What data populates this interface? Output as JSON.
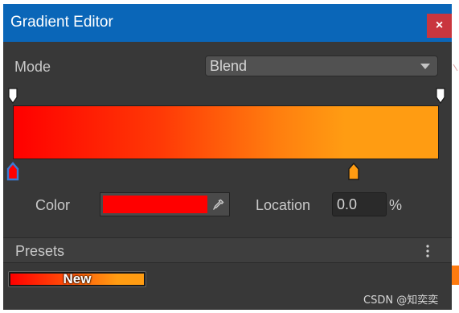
{
  "window": {
    "title": "Gradient Editor",
    "close_label": "×"
  },
  "mode": {
    "label": "Mode",
    "value": "Blend"
  },
  "gradient": {
    "alpha_keys": [
      "alpha-key-start",
      "alpha-key-end"
    ],
    "color_keys": [
      {
        "color": "#ff0000",
        "selected": true
      },
      {
        "color": "#ff9c12",
        "selected": false
      }
    ]
  },
  "color_field": {
    "label": "Color",
    "value": "#ff0000"
  },
  "location_field": {
    "label": "Location",
    "value": "0.0",
    "unit": "%"
  },
  "presets": {
    "label": "Presets",
    "items": [
      {
        "name": "New"
      }
    ]
  },
  "watermark": "CSDN @知奕奕",
  "colors": {
    "titlebar": "#0a66b8",
    "close": "#c9363e",
    "panel": "#383838",
    "selection": "#3a7bd5"
  }
}
